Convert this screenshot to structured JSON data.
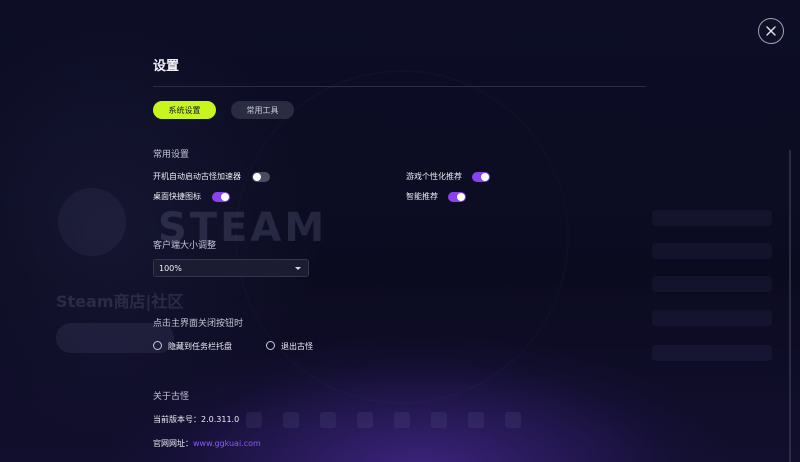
{
  "settings": {
    "title": "设置",
    "tabs": [
      {
        "label": "系统设置",
        "active": true
      },
      {
        "label": "常用工具",
        "active": false
      }
    ],
    "general": {
      "heading": "常用设置",
      "options": [
        {
          "label": "开机自动启动古怪加速器",
          "enabled": false
        },
        {
          "label": "游戏个性化推荐",
          "enabled": true
        },
        {
          "label": "桌面快捷图标",
          "enabled": true
        },
        {
          "label": "智能推荐",
          "enabled": true
        }
      ]
    },
    "client_size": {
      "heading": "客户端大小调整",
      "selected": "100%"
    },
    "close_action": {
      "heading": "点击主界面关闭按钮时",
      "options": [
        "隐藏到任务栏托盘",
        "退出古怪"
      ]
    },
    "about": {
      "heading": "关于古怪",
      "version_label": "当前版本号：",
      "version": "2.0.311.0",
      "site_label": "官网网址：",
      "site_url": "www.ggkuai.com"
    }
  },
  "background": {
    "steam_text": "STEAM",
    "app_title": "Steam商店|社区"
  },
  "colors": {
    "accent_active_tab": "#c8f51e",
    "toggle_on": "#8a41f0",
    "link": "#8b5cf6",
    "background": "#0b0c22"
  },
  "icons": {
    "close": "close-icon"
  }
}
